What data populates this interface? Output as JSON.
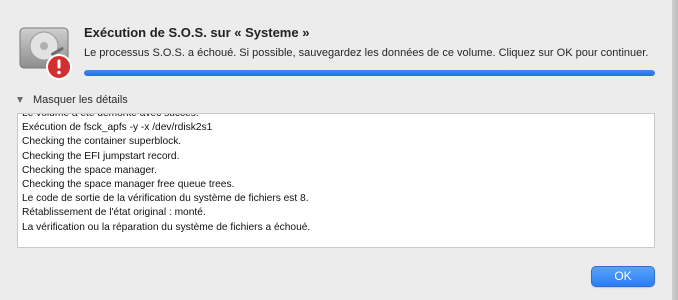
{
  "dialog": {
    "title": "Exécution de S.O.S. sur « Systeme »",
    "message": "Le processus S.O.S. a échoué. Si possible, sauvegardez les données de ce volume. Cliquez sur OK pour continuer.",
    "progress": 1.0
  },
  "details": {
    "toggle_label": "Masquer les détails",
    "log_lines": [
      "Le volume a été démonté avec succès.",
      "Exécution de fsck_apfs -y -x /dev/rdisk2s1",
      "Checking the container superblock.",
      "Checking the EFI jumpstart record.",
      "Checking the space manager.",
      "Checking the space manager free queue trees.",
      "Le code de sortie de la vérification du système de fichiers est 8.",
      "Rétablissement de l'état original : monté.",
      "La vérification ou la réparation du système de fichiers a échoué."
    ]
  },
  "buttons": {
    "ok_label": "OK"
  },
  "colors": {
    "accent": "#2a7ef6",
    "warning": "#d32f2f"
  },
  "icons": {
    "app": "hard-disk-icon",
    "badge": "warning-icon",
    "toggle": "disclosure-triangle-icon"
  }
}
